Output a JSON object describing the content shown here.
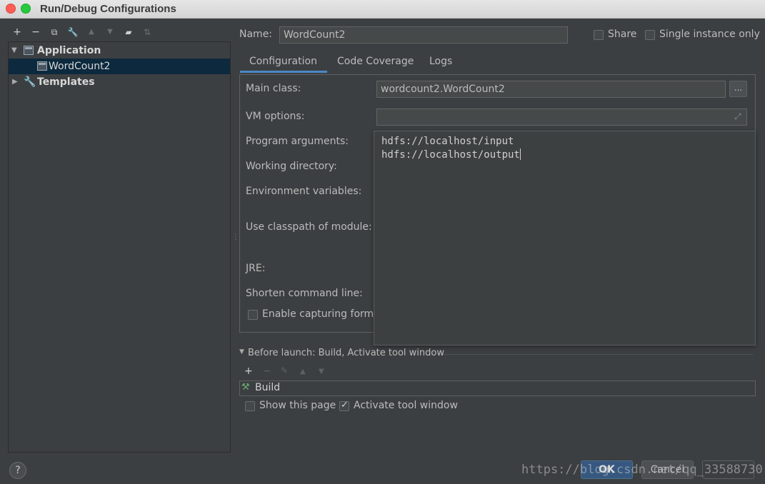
{
  "window": {
    "title": "Run/Debug Configurations"
  },
  "left_toolbar": {
    "icons": [
      "plus-icon",
      "minus-icon",
      "copy-icon",
      "wrench-icon",
      "move-up-icon",
      "move-down-icon",
      "folder-icon",
      "sort-icon"
    ],
    "glyphs": [
      "+",
      "−",
      "⧉",
      "🔧",
      "▲",
      "▼",
      "▰",
      "⇅"
    ]
  },
  "tree": {
    "application": "Application",
    "config_item": "WordCount2",
    "templates": "Templates"
  },
  "header": {
    "name_label": "Name:",
    "name_value": "WordCount2",
    "share_label": "Share",
    "single_instance_label": "Single instance only"
  },
  "tabs": [
    "Configuration",
    "Code Coverage",
    "Logs"
  ],
  "config": {
    "main_class_label": "Main class:",
    "main_class_value": "wordcount2.WordCount2",
    "browse_label": "...",
    "vm_options_label": "VM options:",
    "program_arguments_label": "Program arguments:",
    "working_directory_label": "Working directory:",
    "environment_variables_label": "Environment variables:",
    "classpath_module_label": "Use classpath of module:",
    "jre_label": "JRE:",
    "shorten_cmd_label": "Shorten command line:",
    "enable_capturing_label": "Enable capturing form"
  },
  "program_args_popup": {
    "lines": [
      "hdfs://localhost/input",
      "hdfs://localhost/output"
    ]
  },
  "before_launch": {
    "title": "Before launch: Build, Activate tool window",
    "build_item": "Build",
    "show_page_label": "Show this page",
    "activate_tool_window_label": "Activate tool window"
  },
  "footer": {
    "help": "?",
    "ok": "OK",
    "cancel": "Cancel",
    "watermark": "https://blog.csdn.net/qq_33588730"
  }
}
